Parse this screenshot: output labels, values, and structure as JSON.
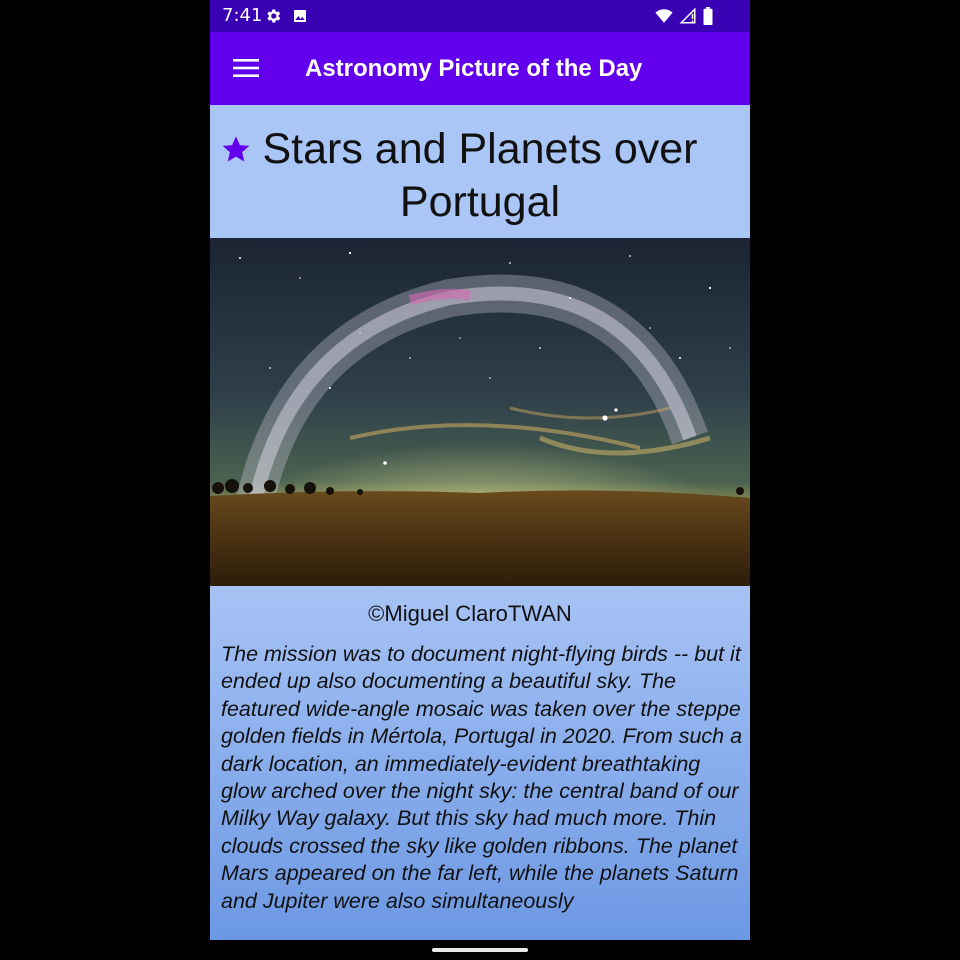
{
  "status_bar": {
    "time": "7:41",
    "left_icons": [
      "settings-gear-icon",
      "image-notification-icon"
    ],
    "right_icons": [
      "wifi-icon",
      "signal-no-data-icon",
      "battery-icon"
    ]
  },
  "app_bar": {
    "menu_icon": "hamburger-menu-icon",
    "title": "Astronomy Picture of the Day",
    "color": "#6200ee"
  },
  "apod": {
    "favorite_icon": "star-icon",
    "title": "Stars and Planets over Portugal",
    "image_alt": "Panoramic night sky with Milky Way arch over golden fields",
    "copyright": "©Miguel ClaroTWAN",
    "explanation": "The mission was to document night-flying birds -- but it ended up also documenting a beautiful sky. The featured wide-angle mosaic was taken over the steppe golden fields in Mértola, Portugal in 2020. From such a dark location, an immediately-evident breathtaking glow arched over the night sky: the central band of our Milky Way galaxy.  But this sky had much more. Thin clouds crossed the sky like golden ribbons. The planet Mars appeared on the far left, while the planets Saturn and Jupiter were also simultaneously"
  },
  "colors": {
    "status_bar": "#3a00b4",
    "accent": "#6200ee",
    "title_background": "#aac6f6"
  }
}
